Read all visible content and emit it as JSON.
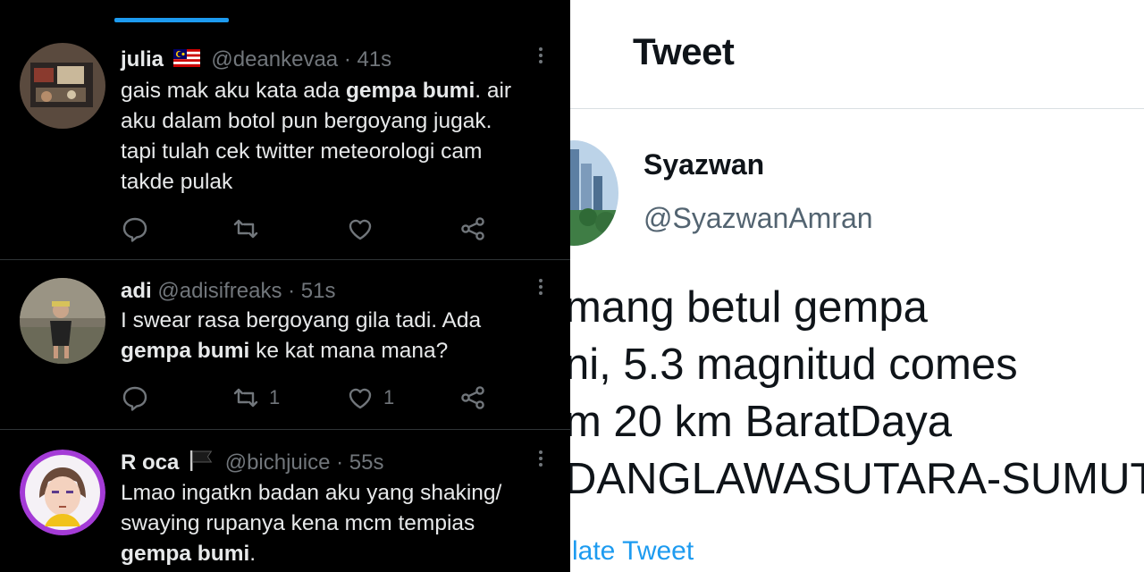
{
  "colors": {
    "dark_bg": "#000000",
    "dark_text": "#e7e9ea",
    "dark_muted": "#71767b",
    "dark_divider": "#2f3336",
    "accent": "#1d9bf0",
    "light_bg": "#ffffff",
    "light_text": "#0f1419",
    "light_muted": "#536471"
  },
  "left_timeline": {
    "tweets": [
      {
        "name": "julia",
        "flag_icon": "malaysia-flag-icon",
        "handle": "@deankevaa",
        "time": "· 41s",
        "text_lines": [
          [
            "gais mak aku kata ada ",
            "gempa bumi",
            ". air"
          ],
          [
            "aku dalam botol pun bergoyang jugak."
          ],
          [
            "tapi tulah cek twitter meteorologi cam"
          ],
          [
            "takde pulak"
          ]
        ],
        "reply_count": "",
        "retweet_count": "",
        "like_count": ""
      },
      {
        "name": "adi",
        "handle": "@adisifreaks",
        "time": "· 51s",
        "text_lines": [
          [
            "I swear rasa bergoyang gila tadi. Ada"
          ],
          [
            "",
            "gempa bumi",
            " ke kat mana mana?"
          ]
        ],
        "reply_count": "",
        "retweet_count": "1",
        "like_count": "1"
      },
      {
        "name": "R oca",
        "flag_icon": "black-flag-icon",
        "handle": "@bichjuice",
        "time": "· 55s",
        "text_lines": [
          [
            "Lmao ingatkn badan aku yang shaking/"
          ],
          [
            "swaying rupanya kena mcm tempias"
          ],
          [
            "",
            "gempa bumi",
            "."
          ]
        ]
      }
    ]
  },
  "right_tweet": {
    "page_title": "Tweet",
    "author_name": "Syazwan",
    "author_handle": "@SyazwanAmran",
    "text_lines": [
      "mang betul gempa",
      "ni, 5.3 magnitud comes",
      "m 20 km BaratDaya",
      "DANGLAWASUTARA-SUMUT"
    ],
    "translate_link": "late Tweet"
  }
}
